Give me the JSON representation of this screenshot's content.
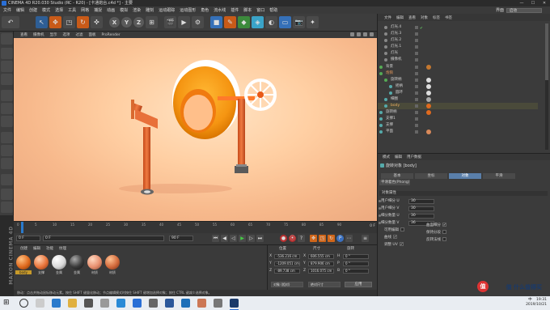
{
  "window": {
    "title": "CINEMA 4D R20.030 Studio (RC - R20) - [卡通炮台.c4d *] - 主要",
    "controls": [
      "—",
      "☐",
      "✕"
    ]
  },
  "menubar": {
    "items": [
      "文件",
      "编辑",
      "创建",
      "模式",
      "选择",
      "工具",
      "网格",
      "捕捉",
      "动画",
      "模拟",
      "渲染",
      "雕刻",
      "运动跟踪",
      "运动图形",
      "角色",
      "流水线",
      "插件",
      "脚本",
      "窗口",
      "帮助"
    ],
    "layout_label": "界面",
    "layout_value": "启动"
  },
  "viewport": {
    "menu": [
      "查看",
      "摄像机",
      "显示",
      "选项",
      "过滤",
      "面板",
      "ProRender"
    ]
  },
  "object_manager": {
    "menu": [
      "文件",
      "编辑",
      "查看",
      "对象",
      "标签",
      "书签"
    ],
    "rows": [
      {
        "name": "灯光.4",
        "level": 1
      },
      {
        "name": "灯光.3",
        "level": 1
      },
      {
        "name": "灯光.2",
        "level": 1
      },
      {
        "name": "灯光.1",
        "level": 1
      },
      {
        "name": "灯光",
        "level": 1
      },
      {
        "name": "摄像机",
        "level": 1
      },
      {
        "name": "背景",
        "level": 0
      },
      {
        "name": "炮筒",
        "level": 0
      },
      {
        "name": "旋转柄",
        "level": 1
      },
      {
        "name": "摇柄",
        "level": 2
      },
      {
        "name": "圆环",
        "level": 2
      },
      {
        "name": "细圈",
        "level": 1
      },
      {
        "name": "body",
        "level": 1
      },
      {
        "name": "旋转柄",
        "level": 0
      },
      {
        "name": "支撑1",
        "level": 0
      },
      {
        "name": "支撑",
        "level": 0
      },
      {
        "name": "平面",
        "level": 0
      }
    ]
  },
  "attribute_manager": {
    "menu": [
      "模式",
      "编辑",
      "用户数据"
    ],
    "title": "旋转对象 [body]",
    "tabs": [
      "基本",
      "坐标",
      "对象",
      "平滑"
    ],
    "active_tab": "对象",
    "subtab": "平滑着色(Phong)",
    "section": "对象属性",
    "fields": [
      {
        "label": "用户细分 U",
        "value": "30"
      },
      {
        "label": "用户细分 V",
        "value": "30"
      },
      {
        "label": "细分数量 U",
        "value": "30"
      },
      {
        "label": "细分数量 V",
        "value": "36"
      }
    ],
    "checks": [
      {
        "label": "可用编辑",
        "value": ""
      },
      {
        "label": "曲面细分",
        "value": "✔"
      },
      {
        "label": "曲线",
        "value": "✔"
      },
      {
        "label": "保持分段",
        "value": ""
      },
      {
        "label": "调整 UV",
        "value": "✔"
      },
      {
        "label": "反转法线",
        "value": ""
      }
    ]
  },
  "timeline": {
    "ticks": [
      "0",
      "5",
      "10",
      "15",
      "20",
      "25",
      "30",
      "35",
      "40",
      "45",
      "50",
      "55",
      "60",
      "65",
      "70",
      "75",
      "80",
      "85",
      "90"
    ],
    "current_frame_label": "0 F",
    "end_frame_label": "0 F"
  },
  "transport": {
    "start": "0 F",
    "current": "0 F",
    "end": "90 F",
    "max": "90 F"
  },
  "material_manager": {
    "menu": [
      "创建",
      "编辑",
      "功能",
      "纹理"
    ],
    "materials": [
      {
        "name": "body",
        "color": "#e06a1e",
        "selected": true
      },
      {
        "name": "支撑",
        "color": "#e8743a"
      },
      {
        "name": "金属",
        "color": "#d9d9d9"
      },
      {
        "name": "金属",
        "color": "#3a3a3a"
      },
      {
        "name": "材质",
        "color": "#e89070"
      },
      {
        "name": "材质",
        "color": "#d26a3c"
      }
    ]
  },
  "coordinates": {
    "headers": [
      "位置",
      "尺寸",
      "旋转"
    ],
    "rows": [
      {
        "axis": "X",
        "pos": "-536.216 cm",
        "size": "606.555 cm",
        "rot_axis": "H",
        "rot": "0 °"
      },
      {
        "axis": "Y",
        "pos": "-1209.051 cm",
        "size": "879.906 cm",
        "rot_axis": "P",
        "rot": "0 °"
      },
      {
        "axis": "Z",
        "pos": "-89.738 cm",
        "size": "1016.075 cm",
        "rot_axis": "B",
        "rot": "0 °"
      }
    ],
    "mode": "对象 (相对)",
    "size_mode": "绝对尺寸",
    "apply": "应用"
  },
  "status": {
    "text": "移动：点击并拖动鼠标移动元素。按住 SHIFT 键量化移动；节点编辑模式时按住 SHIFT 键增加选择对象；按住 CTRL 键减少选择对象。"
  },
  "taskbar": {
    "time": "19:31",
    "date": "2019/10/21",
    "lang": "中"
  },
  "watermark": {
    "text": "值 什么值得买"
  },
  "branding": {
    "vertical": "MAXON CINEMA 4D"
  },
  "colors": {
    "accent": "#2e5e95",
    "orange": "#d0661a"
  }
}
